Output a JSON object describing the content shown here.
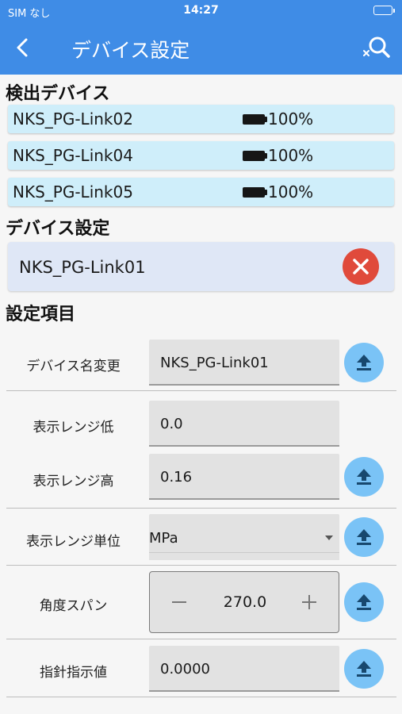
{
  "status_bar": {
    "carrier": "SIM なし",
    "time": "14:27"
  },
  "nav": {
    "title": "デバイス設定"
  },
  "detected": {
    "heading": "検出デバイス",
    "devices": [
      {
        "name": "NKS_PG-Link02",
        "battery": "100%"
      },
      {
        "name": "NKS_PG-Link04",
        "battery": "100%"
      },
      {
        "name": "NKS_PG-Link05",
        "battery": "100%"
      }
    ]
  },
  "device_settings": {
    "heading": "デバイス設定",
    "selected_device": "NKS_PG-Link01"
  },
  "settings": {
    "heading": "設定項目",
    "device_name": {
      "label": "デバイス名変更",
      "value": "NKS_PG-Link01"
    },
    "range_low": {
      "label": "表示レンジ低",
      "value": "0.0"
    },
    "range_high": {
      "label": "表示レンジ高",
      "value": "0.16"
    },
    "range_unit": {
      "label": "表示レンジ単位",
      "value": "MPa"
    },
    "angle_span": {
      "label": "角度スパン",
      "value": "270.0"
    },
    "pointer_value": {
      "label": "指針指示値",
      "value": "0.0000"
    }
  },
  "colors": {
    "header": "#3f8ce6",
    "detected_row": "#cfeefa",
    "upload_button": "#7ac3f6",
    "clear_button": "#e04a3b"
  },
  "icons": [
    "back-chevron-icon",
    "search-clear-icon",
    "battery-icon",
    "clear-icon",
    "upload-icon"
  ]
}
